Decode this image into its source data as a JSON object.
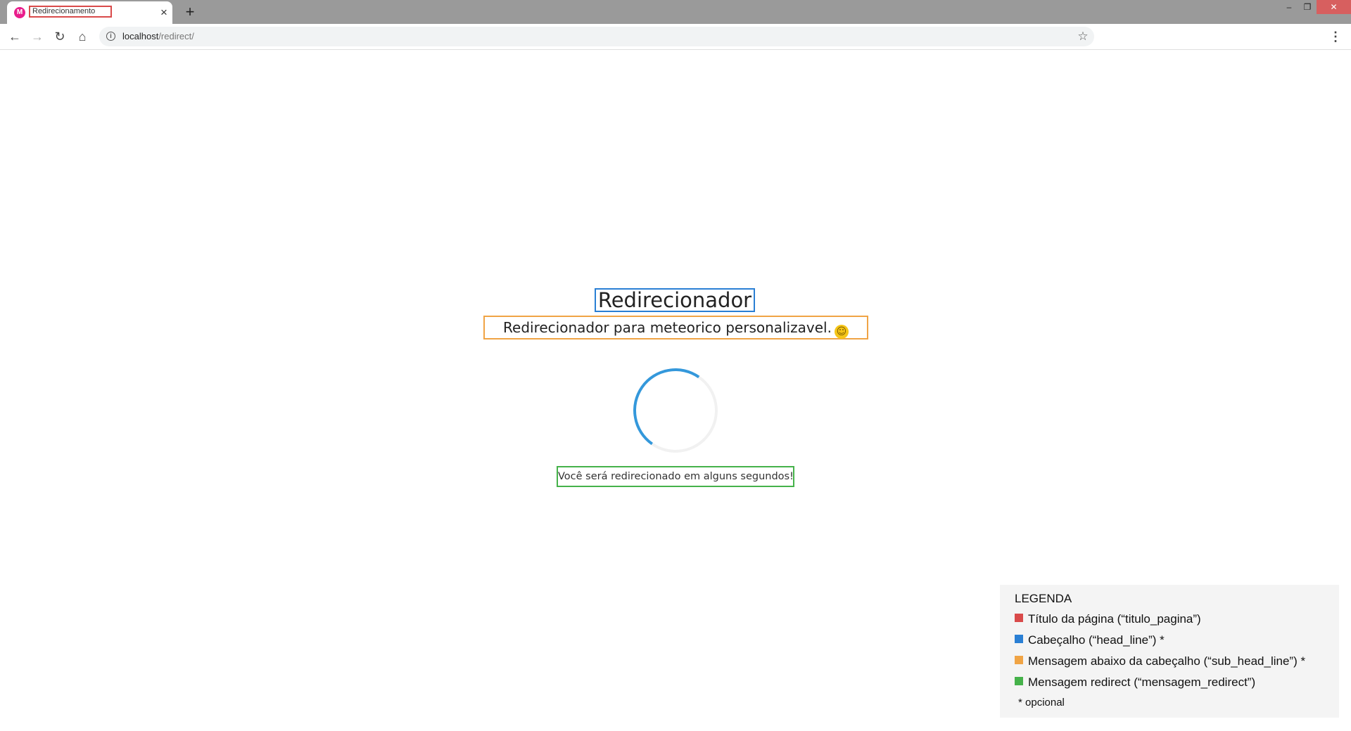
{
  "browser": {
    "tab": {
      "favicon": "M",
      "title": "Redirecionamento",
      "close": "×"
    },
    "new_tab": "+",
    "window_controls": {
      "minimize": "–",
      "maximize": "❐",
      "close": "✕"
    },
    "nav": {
      "back": "←",
      "forward": "→",
      "reload": "↻",
      "home": "⌂"
    },
    "url": {
      "host": "localhost",
      "path": "/redirect/"
    },
    "info_icon": "i",
    "star": "☆",
    "menu": "⋮"
  },
  "page": {
    "head_line": "Redirecionador",
    "sub_head_line": "Redirecionador para meteorico personalizavel.",
    "smiley": "☺",
    "mensagem_redirect": "Você será redirecionado em alguns segundos!"
  },
  "legend": {
    "title": "LEGENDA",
    "items": [
      {
        "color": "#d94a4a",
        "label": "Título da página (“titulo_pagina”)"
      },
      {
        "color": "#2a7fd4",
        "label": "Cabeçalho (“head_line”) *"
      },
      {
        "color": "#f0a445",
        "label": "Mensagem abaixo da cabeçalho (“sub_head_line”) *"
      },
      {
        "color": "#45b24a",
        "label": "Mensagem redirect (“mensagem_redirect”)"
      }
    ],
    "note": "* opcional"
  }
}
